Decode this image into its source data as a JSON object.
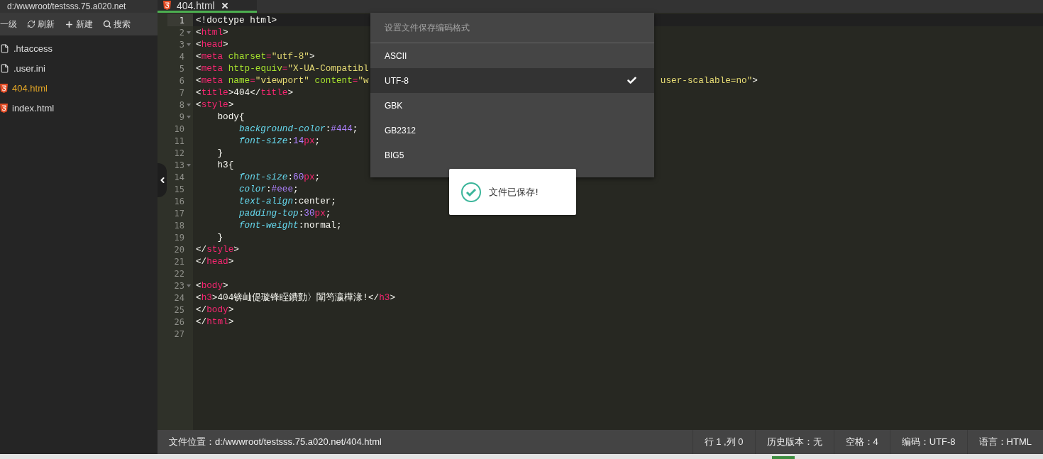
{
  "sidebar": {
    "path": "d:/wwwroot/testsss.75.a020.net",
    "toolbar": [
      {
        "kind": "up",
        "label": "一级"
      },
      {
        "kind": "refresh",
        "label": "刷新"
      },
      {
        "kind": "new",
        "label": "新建"
      },
      {
        "kind": "search",
        "label": "搜索"
      }
    ],
    "files": [
      {
        "name": ".htaccess",
        "kind": "file",
        "selected": false
      },
      {
        "name": ".user.ini",
        "kind": "file",
        "selected": false
      },
      {
        "name": "404.html",
        "kind": "html",
        "selected": true
      },
      {
        "name": "index.html",
        "kind": "html",
        "selected": false
      }
    ]
  },
  "tabs": [
    {
      "label": "404.html",
      "kind": "html",
      "selected": true
    }
  ],
  "editor": {
    "lines": [
      {
        "number": "1",
        "foldable": false,
        "current": true,
        "tokens": [
          {
            "kind": "plain",
            "text": "<!doctype html>"
          }
        ]
      },
      {
        "number": "2",
        "foldable": true,
        "current": false,
        "tokens": [
          {
            "kind": "plain",
            "text": "<"
          },
          {
            "kind": "tag",
            "text": "html"
          },
          {
            "kind": "plain",
            "text": ">"
          }
        ]
      },
      {
        "number": "3",
        "foldable": true,
        "current": false,
        "tokens": [
          {
            "kind": "plain",
            "text": "<"
          },
          {
            "kind": "tag",
            "text": "head"
          },
          {
            "kind": "plain",
            "text": ">"
          }
        ]
      },
      {
        "number": "4",
        "foldable": false,
        "current": false,
        "tokens": [
          {
            "kind": "plain",
            "text": "<"
          },
          {
            "kind": "tag",
            "text": "meta"
          },
          {
            "kind": "attr",
            "text": " charset"
          },
          {
            "kind": "tag",
            "text": "="
          },
          {
            "kind": "string",
            "text": "\"utf-8\""
          },
          {
            "kind": "plain",
            "text": ">"
          }
        ]
      },
      {
        "number": "5",
        "foldable": false,
        "current": false,
        "tokens": [
          {
            "kind": "plain",
            "text": "<"
          },
          {
            "kind": "tag",
            "text": "meta"
          },
          {
            "kind": "attr",
            "text": " http-equiv"
          },
          {
            "kind": "tag",
            "text": "="
          },
          {
            "kind": "string",
            "text": "\"X-UA-Compatibl"
          }
        ]
      },
      {
        "number": "6",
        "foldable": false,
        "current": false,
        "tokens": [
          {
            "kind": "plain",
            "text": "<"
          },
          {
            "kind": "tag",
            "text": "meta"
          },
          {
            "kind": "attr",
            "text": " name"
          },
          {
            "kind": "tag",
            "text": "="
          },
          {
            "kind": "string",
            "text": "\"viewport\""
          },
          {
            "kind": "attr",
            "text": " content"
          },
          {
            "kind": "tag",
            "text": "="
          },
          {
            "kind": "string",
            "text": "\"w"
          }
        ],
        "tail": [
          {
            "kind": "string",
            "text": "user-scalable=no\""
          },
          {
            "kind": "plain",
            "text": ">"
          }
        ]
      },
      {
        "number": "7",
        "foldable": false,
        "current": false,
        "tokens": [
          {
            "kind": "plain",
            "text": "<"
          },
          {
            "kind": "tag",
            "text": "title"
          },
          {
            "kind": "plain",
            "text": ">404</"
          },
          {
            "kind": "tag",
            "text": "title"
          },
          {
            "kind": "plain",
            "text": ">"
          }
        ]
      },
      {
        "number": "8",
        "foldable": true,
        "current": false,
        "tokens": [
          {
            "kind": "plain",
            "text": "<"
          },
          {
            "kind": "tag",
            "text": "style"
          },
          {
            "kind": "plain",
            "text": ">"
          }
        ]
      },
      {
        "number": "9",
        "foldable": true,
        "current": false,
        "tokens": [
          {
            "kind": "plain",
            "text": "    body{"
          }
        ]
      },
      {
        "number": "10",
        "foldable": false,
        "current": false,
        "tokens": [
          {
            "kind": "prop",
            "text": "        background-color"
          },
          {
            "kind": "plain",
            "text": ":"
          },
          {
            "kind": "number",
            "text": "#444"
          },
          {
            "kind": "plain",
            "text": ";"
          }
        ]
      },
      {
        "number": "11",
        "foldable": false,
        "current": false,
        "tokens": [
          {
            "kind": "prop",
            "text": "        font-size"
          },
          {
            "kind": "plain",
            "text": ":"
          },
          {
            "kind": "number",
            "text": "14"
          },
          {
            "kind": "tag",
            "text": "px"
          },
          {
            "kind": "plain",
            "text": ";"
          }
        ]
      },
      {
        "number": "12",
        "foldable": false,
        "current": false,
        "tokens": [
          {
            "kind": "plain",
            "text": "    }"
          }
        ]
      },
      {
        "number": "13",
        "foldable": true,
        "current": false,
        "tokens": [
          {
            "kind": "plain",
            "text": "    h3{"
          }
        ]
      },
      {
        "number": "14",
        "foldable": false,
        "current": false,
        "tokens": [
          {
            "kind": "prop",
            "text": "        font-size"
          },
          {
            "kind": "plain",
            "text": ":"
          },
          {
            "kind": "number",
            "text": "60"
          },
          {
            "kind": "tag",
            "text": "px"
          },
          {
            "kind": "plain",
            "text": ";"
          }
        ]
      },
      {
        "number": "15",
        "foldable": false,
        "current": false,
        "tokens": [
          {
            "kind": "prop",
            "text": "        color"
          },
          {
            "kind": "plain",
            "text": ":"
          },
          {
            "kind": "number",
            "text": "#eee"
          },
          {
            "kind": "plain",
            "text": ";"
          }
        ]
      },
      {
        "number": "16",
        "foldable": false,
        "current": false,
        "tokens": [
          {
            "kind": "prop",
            "text": "        text-align"
          },
          {
            "kind": "plain",
            "text": ":center;"
          }
        ]
      },
      {
        "number": "17",
        "foldable": false,
        "current": false,
        "tokens": [
          {
            "kind": "prop",
            "text": "        padding-top"
          },
          {
            "kind": "plain",
            "text": ":"
          },
          {
            "kind": "number",
            "text": "30"
          },
          {
            "kind": "tag",
            "text": "px"
          },
          {
            "kind": "plain",
            "text": ";"
          }
        ]
      },
      {
        "number": "18",
        "foldable": false,
        "current": false,
        "tokens": [
          {
            "kind": "prop",
            "text": "        font-weight"
          },
          {
            "kind": "plain",
            "text": ":normal;"
          }
        ]
      },
      {
        "number": "19",
        "foldable": false,
        "current": false,
        "tokens": [
          {
            "kind": "plain",
            "text": "    }"
          }
        ]
      },
      {
        "number": "20",
        "foldable": false,
        "current": false,
        "tokens": [
          {
            "kind": "plain",
            "text": "</"
          },
          {
            "kind": "tag",
            "text": "style"
          },
          {
            "kind": "plain",
            "text": ">"
          }
        ]
      },
      {
        "number": "21",
        "foldable": false,
        "current": false,
        "tokens": [
          {
            "kind": "plain",
            "text": "</"
          },
          {
            "kind": "tag",
            "text": "head"
          },
          {
            "kind": "plain",
            "text": ">"
          }
        ]
      },
      {
        "number": "22",
        "foldable": false,
        "current": false
      },
      {
        "number": "23",
        "foldable": true,
        "current": false,
        "tokens": [
          {
            "kind": "plain",
            "text": "<"
          },
          {
            "kind": "tag",
            "text": "body"
          },
          {
            "kind": "plain",
            "text": ">"
          }
        ]
      },
      {
        "number": "24",
        "foldable": false,
        "current": false,
        "tokens": [
          {
            "kind": "plain",
            "text": "<"
          },
          {
            "kind": "tag",
            "text": "h3"
          },
          {
            "kind": "plain",
            "text": ">404锛屾偍璇锋眰鐨勯〉闈笉瀛樺湪!</"
          },
          {
            "kind": "tag",
            "text": "h3"
          },
          {
            "kind": "plain",
            "text": ">"
          }
        ]
      },
      {
        "number": "25",
        "foldable": false,
        "current": false,
        "tokens": [
          {
            "kind": "plain",
            "text": "</"
          },
          {
            "kind": "tag",
            "text": "body"
          },
          {
            "kind": "plain",
            "text": ">"
          }
        ]
      },
      {
        "number": "26",
        "foldable": false,
        "current": false,
        "tokens": [
          {
            "kind": "plain",
            "text": "</"
          },
          {
            "kind": "tag",
            "text": "html"
          },
          {
            "kind": "plain",
            "text": ">"
          }
        ]
      },
      {
        "number": "27",
        "foldable": false,
        "current": false
      }
    ]
  },
  "encoding_menu": {
    "title": "设置文件保存编码格式",
    "options": [
      {
        "label": "ASCII",
        "selected": false
      },
      {
        "label": "UTF-8",
        "selected": true
      },
      {
        "label": "GBK",
        "selected": false
      },
      {
        "label": "GB2312",
        "selected": false
      },
      {
        "label": "BIG5",
        "selected": false
      }
    ]
  },
  "toast": {
    "message": "文件已保存!"
  },
  "status_bar": {
    "location": "文件位置：d:/wwwroot/testsss.75.a020.net/404.html",
    "items": [
      "行 1 ,列 0",
      "历史版本：无",
      "空格：4",
      "编码：UTF-8",
      "语言：HTML"
    ]
  }
}
